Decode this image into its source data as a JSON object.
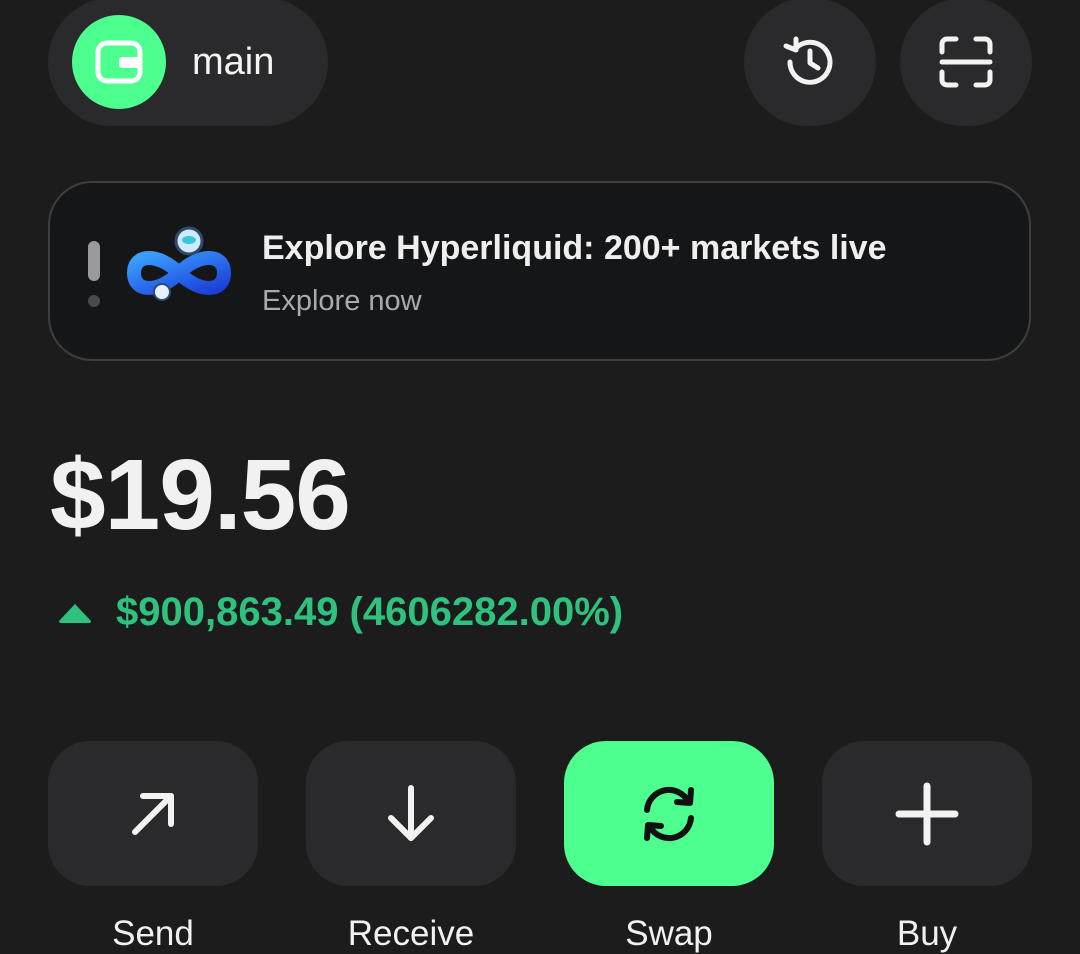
{
  "header": {
    "account_name": "main",
    "wallet_icon": "wallet-icon",
    "history_icon": "history-icon",
    "scan_icon": "scan-icon"
  },
  "banner": {
    "title": "Explore Hyperliquid: 200+ markets live",
    "subtitle": "Explore now",
    "pager_count": 2,
    "pager_active": 0
  },
  "portfolio": {
    "balance": "$19.56",
    "change_text": "$900,863.49 (4606282.00%)",
    "change_direction": "up"
  },
  "actions": [
    {
      "label": "Send",
      "icon": "arrow-up-right-icon"
    },
    {
      "label": "Receive",
      "icon": "arrow-down-icon"
    },
    {
      "label": "Swap",
      "icon": "swap-icon"
    },
    {
      "label": "Buy",
      "icon": "plus-icon"
    }
  ],
  "colors": {
    "background": "#1c1c1d",
    "surface": "#2a2a2c",
    "accent": "#4cff8f",
    "positive": "#2ec27e",
    "muted_text": "#a9aaad"
  }
}
